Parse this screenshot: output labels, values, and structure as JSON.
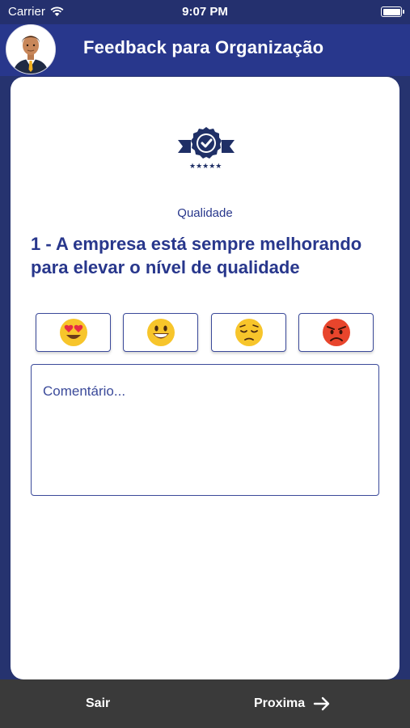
{
  "status_bar": {
    "carrier": "Carrier",
    "time": "9:07 PM"
  },
  "header": {
    "title": "Feedback para Organização"
  },
  "card": {
    "category": "Qualidade",
    "question": "1 - A empresa está sempre melhorando para elevar o nível de qualidade",
    "emoji_options": [
      {
        "icon": "heart-eyes-emoji",
        "glyph": "😍"
      },
      {
        "icon": "grinning-face-emoji",
        "glyph": "😃"
      },
      {
        "icon": "pensive-face-emoji",
        "glyph": "😔"
      },
      {
        "icon": "angry-face-emoji",
        "glyph": "😡"
      }
    ],
    "comment_placeholder": "Comentário..."
  },
  "footer": {
    "left_label": "Sair",
    "right_label": "Proxima"
  },
  "colors": {
    "primary": "#28378c",
    "footer": "#3a3a3a",
    "angry": "#e8452c",
    "emoji_yellow": "#f7c52b"
  }
}
